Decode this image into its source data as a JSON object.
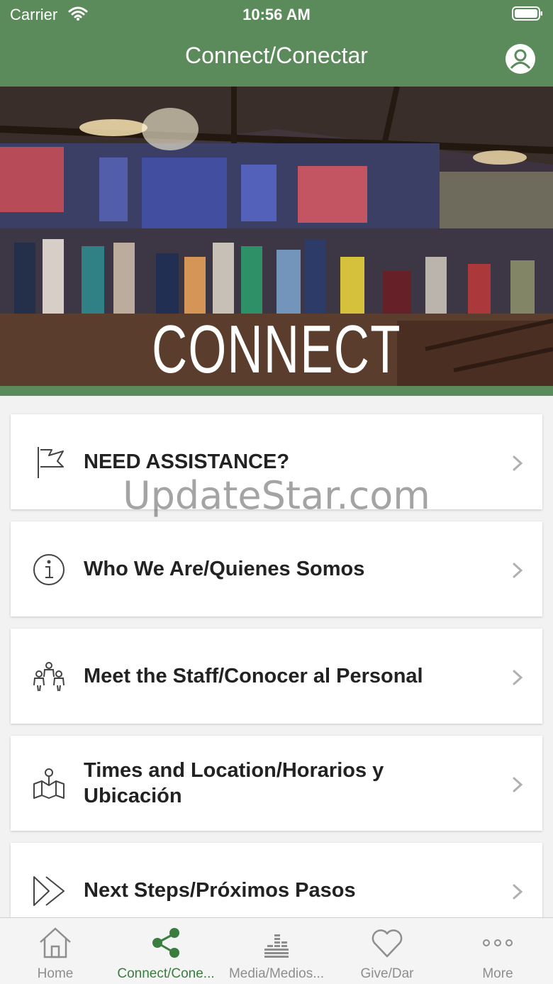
{
  "status": {
    "carrier": "Carrier",
    "time": "10:56 AM"
  },
  "header": {
    "title": "Connect/Conectar"
  },
  "hero": {
    "overlay_text": "CONNECT"
  },
  "watermark": "UpdateStar.com",
  "items": [
    {
      "label": "NEED ASSISTANCE?",
      "icon": "flag-icon"
    },
    {
      "label": "Who We Are/Quienes Somos",
      "icon": "info-icon"
    },
    {
      "label": "Meet the Staff/Conocer al Personal",
      "icon": "people-icon"
    },
    {
      "label": "Times and Location/Horarios y Ubicación",
      "icon": "map-icon"
    },
    {
      "label": "Next Steps/Próximos Pasos",
      "icon": "fast-forward-icon"
    }
  ],
  "tabs": [
    {
      "label": "Home",
      "icon": "home-icon",
      "active": false
    },
    {
      "label": "Connect/Cone...",
      "icon": "share-icon",
      "active": true
    },
    {
      "label": "Media/Medios...",
      "icon": "media-icon",
      "active": false
    },
    {
      "label": "Give/Dar",
      "icon": "heart-icon",
      "active": false
    },
    {
      "label": "More",
      "icon": "more-icon",
      "active": false
    }
  ],
  "colors": {
    "brand_green": "#5b8b5a",
    "active_tab": "#3a7d3f",
    "inactive_tab": "#8e8e8e"
  }
}
